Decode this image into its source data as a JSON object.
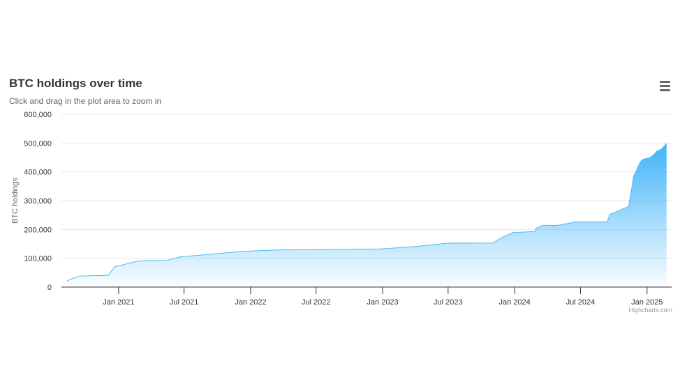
{
  "title": "BTC holdings over time",
  "subtitle": "Click and drag in the plot area to zoom in",
  "credits": "Highcharts.com",
  "menu_icon": "hamburger-menu-icon",
  "colors": {
    "line": "#4dbbf4",
    "fill_top": "#3fb3f8",
    "grid": "#e6e6e6",
    "axis": "#333333"
  },
  "chart_data": {
    "type": "area",
    "title": "BTC holdings over time",
    "ylabel": "BTC holdings",
    "xlabel": "",
    "ylim": [
      0,
      600000
    ],
    "yticks": [
      0,
      100000,
      200000,
      300000,
      400000,
      500000,
      600000
    ],
    "ytick_labels": [
      "0",
      "100,000",
      "200,000",
      "300,000",
      "400,000",
      "500,000",
      "600,000"
    ],
    "xticks": [
      "2021-01-01",
      "2021-07-01",
      "2022-01-01",
      "2022-07-01",
      "2023-01-01",
      "2023-07-01",
      "2024-01-01",
      "2024-07-01",
      "2025-01-01"
    ],
    "xtick_labels": [
      "Jan 2021",
      "Jul 2021",
      "Jan 2022",
      "Jul 2022",
      "Jan 2023",
      "Jul 2023",
      "Jan 2024",
      "Jul 2024",
      "Jan 2025"
    ],
    "grid": true,
    "legend": false,
    "series": [
      {
        "x": [
          "2020-08-11",
          "2020-09-14",
          "2020-12-04",
          "2020-12-21",
          "2021-02-24",
          "2021-03-01",
          "2021-05-13",
          "2021-06-21",
          "2021-09-13",
          "2021-12-09",
          "2022-03-31",
          "2022-06-30",
          "2022-12-27",
          "2023-03-27",
          "2023-06-28",
          "2023-11-01",
          "2023-11-30",
          "2023-12-27",
          "2024-02-26",
          "2024-03-01",
          "2024-03-19",
          "2024-04-29",
          "2024-06-20",
          "2024-08-01",
          "2024-09-13",
          "2024-09-20",
          "2024-11-11",
          "2024-11-18",
          "2024-11-25",
          "2024-12-02",
          "2024-12-09",
          "2024-12-16",
          "2024-12-23",
          "2024-12-30",
          "2025-01-06",
          "2025-01-21",
          "2025-01-27",
          "2025-02-10",
          "2025-02-24"
        ],
        "y": [
          21454,
          38250,
          40824,
          70470,
          90531,
          91064,
          92079,
          105085,
          114042,
          124391,
          129218,
          129699,
          132500,
          140000,
          152333,
          152800,
          174530,
          189150,
          193000,
          205000,
          214246,
          214400,
          226331,
          226500,
          226500,
          252220,
          279420,
          331200,
          386700,
          402100,
          423650,
          439000,
          444262,
          446400,
          447470,
          461000,
          471107,
          478740,
          499096
        ]
      }
    ]
  }
}
